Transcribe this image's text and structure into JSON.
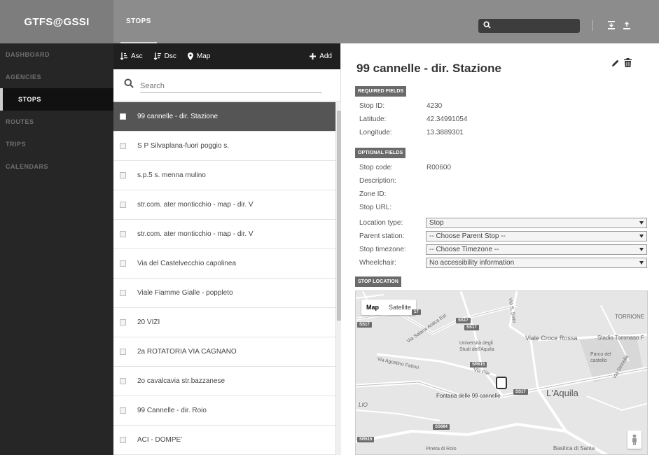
{
  "app": {
    "brand": "GTFS@GSSI"
  },
  "topnav": {
    "items": [
      {
        "label": "STOPS",
        "active": true
      }
    ]
  },
  "header_search": {
    "placeholder": ""
  },
  "sidebar": {
    "items": [
      {
        "label": "DASHBOARD",
        "active": false
      },
      {
        "label": "AGENCIES",
        "active": false
      },
      {
        "label": "STOPS",
        "active": true
      },
      {
        "label": "ROUTES",
        "active": false
      },
      {
        "label": "TRIPS",
        "active": false
      },
      {
        "label": "CALENDARS",
        "active": false
      }
    ]
  },
  "toolbar": {
    "asc": "Asc",
    "dsc": "Dsc",
    "map": "Map",
    "add": "Add"
  },
  "list_search": {
    "placeholder": "Search"
  },
  "stops": [
    {
      "name": "99 cannelle - dir. Stazione",
      "selected": true
    },
    {
      "name": "S P Silvaplana-fuori poggio s.",
      "selected": false
    },
    {
      "name": "s.p.5 s. menna mulino",
      "selected": false
    },
    {
      "name": "str.com. ater monticchio - map - dir. V",
      "selected": false
    },
    {
      "name": "str.com. ater monticchio - map - dir. V",
      "selected": false
    },
    {
      "name": "Via del Castelvecchio capolinea",
      "selected": false
    },
    {
      "name": "Viale Fiamme Gialle - poppleto",
      "selected": false
    },
    {
      "name": "20 VIZI",
      "selected": false
    },
    {
      "name": "2a ROTATORIA VIA CAGNANO",
      "selected": false
    },
    {
      "name": "2o cavalcavia str.bazzanese",
      "selected": false
    },
    {
      "name": "99 Cannelle - dir. Roio",
      "selected": false
    },
    {
      "name": "ACI - DOMPE'",
      "selected": false
    }
  ],
  "detail": {
    "title": "99 cannelle - dir. Stazione",
    "required_section": "REQUIRED FIELDS",
    "required": [
      {
        "label": "Stop ID:",
        "value": "4230"
      },
      {
        "label": "Latitude:",
        "value": "42.34991054"
      },
      {
        "label": "Longitude:",
        "value": "13.3889301"
      }
    ],
    "optional_section": "OPTIONAL FIELDS",
    "optional": [
      {
        "label": "Stop code:",
        "value": "R00600"
      },
      {
        "label": "Description:",
        "value": ""
      },
      {
        "label": "Zone ID:",
        "value": ""
      },
      {
        "label": "Stop URL:",
        "value": ""
      }
    ],
    "selects": [
      {
        "label": "Location type:",
        "value": "Stop"
      },
      {
        "label": "Parent station:",
        "value": "-- Choose Parent Stop --"
      },
      {
        "label": "Stop timezone:",
        "value": "-- Choose Timezone --"
      },
      {
        "label": "Wheelchair:",
        "value": "No accessibility information"
      }
    ],
    "location_section": "STOP LOCATION"
  },
  "map": {
    "toggle_map": "Map",
    "toggle_satellite": "Satellite",
    "labels": {
      "torrione": "TORRIONE",
      "viale_croce_rossa": "Viale Croce Rossa",
      "stadio": "Stadio Tommaso F",
      "universita": "Università degli Studi dell'Aquila",
      "parco": "Parco del castello",
      "laquila": "L'Aquila",
      "fontana": "Fontana delle 99 cannelle",
      "via_agostino": "Via Agostino Fattori",
      "via_pile": "Via Pile",
      "via_salaria": "Via Salaria Antica Est",
      "via_s_sisto": "Via S. Sisto",
      "via_strinella": "Via Strinella",
      "pineta": "Pineta di Roio",
      "basilica": "Basilica di Santa",
      "lio": "LIO"
    },
    "road_tags": [
      "SS17",
      "SS17",
      "SS17",
      "SR615",
      "SS17",
      "SS684",
      "SR615",
      "17"
    ]
  },
  "colors": {
    "topbar": "#8c8c8c",
    "sidebar": "#262626",
    "toolbar": "#1f1f1f",
    "selected_row": "#555555"
  }
}
